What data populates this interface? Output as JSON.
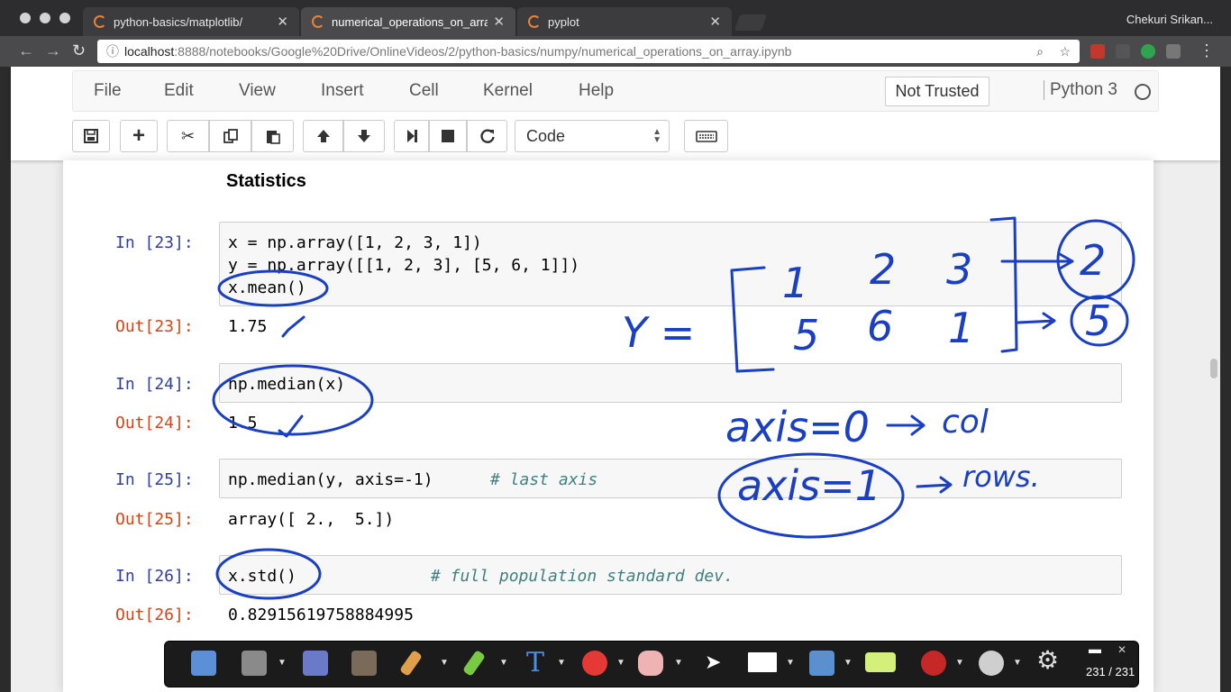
{
  "browser": {
    "tabs": [
      {
        "label": "python-basics/matplotlib/"
      },
      {
        "label": "numerical_operations_on_array"
      },
      {
        "label": "pyplot"
      }
    ],
    "profile": "Chekuri Srikan...",
    "url_host": "localhost",
    "url_path": ":8888/notebooks/Google%20Drive/OnlineVideos/2/python-basics/numpy/numerical_operations_on_array.ipynb"
  },
  "menubar": {
    "items": [
      "File",
      "Edit",
      "View",
      "Insert",
      "Cell",
      "Kernel",
      "Help"
    ],
    "trust": "Not Trusted",
    "kernel": "Python 3"
  },
  "toolbar": {
    "cell_type": "Code"
  },
  "notebook": {
    "heading": "Statistics",
    "cells": [
      {
        "in": "In [23]:",
        "lines": [
          "x = np.array([1, 2, 3, 1])",
          "y = np.array([[1, 2, 3], [5, 6, 1]])",
          "x.mean()"
        ],
        "out": "Out[23]:",
        "result": "1.75"
      },
      {
        "in": "In [24]:",
        "lines": [
          "np.median(x)"
        ],
        "out": "Out[24]:",
        "result": "1.5"
      },
      {
        "in": "In [25]:",
        "code": "np.median(y, axis=-1)",
        "comment": "# last axis",
        "out": "Out[25]:",
        "result": "array([ 2.,  5.])"
      },
      {
        "in": "In [26]:",
        "code": "x.std()",
        "comment": "# full population standard dev.",
        "out": "Out[26]:",
        "result": "0.82915619758884995"
      }
    ]
  },
  "annotation_toolbar": {
    "page_counter": "231 / 231"
  },
  "handwriting": {
    "y_label": "Y =",
    "matrix_row1": [
      "1",
      "2",
      "3"
    ],
    "matrix_row2": [
      "5",
      "6",
      "1"
    ],
    "row_result1": "2",
    "row_result2": "5",
    "axis0": "axis=0",
    "axis0_note": "col",
    "axis1": "axis=1",
    "axis1_note": "rows."
  }
}
